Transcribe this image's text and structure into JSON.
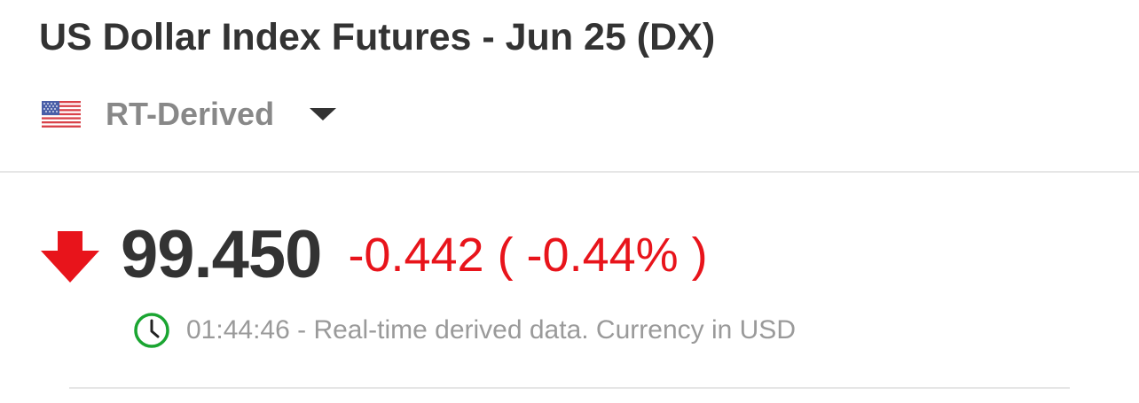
{
  "header": {
    "title": "US Dollar Index Futures - Jun 25 (DX)"
  },
  "source": {
    "flag_icon": "us-flag-icon",
    "label": "RT-Derived",
    "dropdown_icon": "caret-down-icon"
  },
  "quote": {
    "direction_icon": "down-arrow-icon",
    "price": "99.450",
    "change": "-0.442 ( -0.44% )",
    "direction": "down",
    "change_color": "#e8141b"
  },
  "status": {
    "clock_icon": "clock-icon",
    "text": "01:44:46 - Real-time derived data. Currency in USD",
    "clock_color": "#1aa531"
  }
}
